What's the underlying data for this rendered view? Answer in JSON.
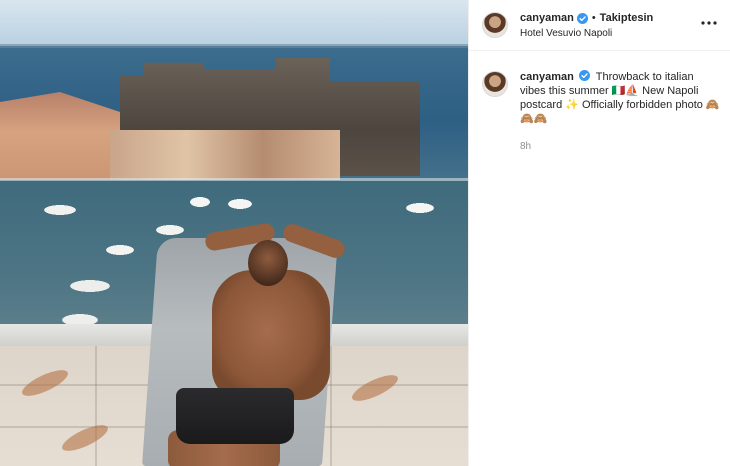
{
  "post": {
    "header": {
      "username": "canyaman",
      "separator": "•",
      "follow_label": "Takiptesin",
      "location": "Hotel Vesuvio Napoli",
      "more_icon": "more-horizontal-icon"
    },
    "caption": {
      "username": "canyaman",
      "text": "Throwback to italian vibes this summer 🇮🇹⛵ New Napoli postcard ✨ Officially forbidden photo 🙈🙈🙈",
      "timestamp": "8h"
    },
    "colors": {
      "verified": "#3897f0",
      "text": "#262626",
      "muted": "#8e8e8e",
      "border": "#efefef"
    }
  }
}
